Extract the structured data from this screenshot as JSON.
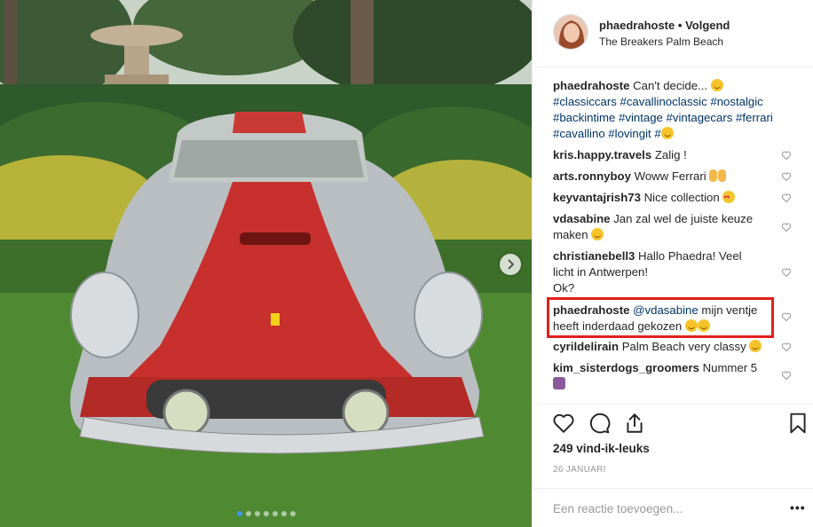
{
  "post": {
    "image_alt": "Red and silver classic Ferrari parked on grass in front of a garden with a fountain and palm trees",
    "carousel_dots": 7,
    "active_dot": 0
  },
  "header": {
    "username": "phaedrahoste",
    "separator": "•",
    "follow_label": "Volgend",
    "location": "The Breakers Palm Beach"
  },
  "caption": {
    "username": "phaedrahoste",
    "text": "Can't decide...",
    "tags_line1": "#classiccars #cavallinoclassic #nostalgic",
    "tags_line2": "#backintime #vintage #vintagecars #ferrari",
    "tags_line3": "#cavallino #lovingit #"
  },
  "comments": [
    {
      "username": "kris.happy.travels",
      "text": "Zalig !"
    },
    {
      "username": "arts.ronnyboy",
      "text": "Woww Ferrari"
    },
    {
      "username": "keyvantajrish73",
      "text": "Nice collection"
    },
    {
      "username": "vdasabine",
      "text_line1": "Jan zal wel de juiste keuze",
      "text_line2": "maken"
    },
    {
      "username": "christianebell3",
      "text_line1": "Hallo Phaedra! Veel",
      "text_line2": "licht in Antwerpen!",
      "text_line3": "Ok?"
    },
    {
      "username": "phaedrahoste",
      "mention": "@vdasabine",
      "text_line1": "mijn ventje",
      "text_line2": "heeft inderdaad gekozen"
    },
    {
      "username": "cyrildelirain",
      "text": "Palm Beach very classy"
    },
    {
      "username": "kim_sisterdogs_groomers",
      "text": "Nummer 5"
    }
  ],
  "likes_text": "249 vind-ik-leuks",
  "date_text": "26 JANUARI",
  "comment_input": {
    "placeholder": "Een reactie toevoegen..."
  },
  "more_options": "•••",
  "colors": {
    "link": "#003569",
    "highlight_box": "#e0201c",
    "active_dot": "#3897f0"
  }
}
